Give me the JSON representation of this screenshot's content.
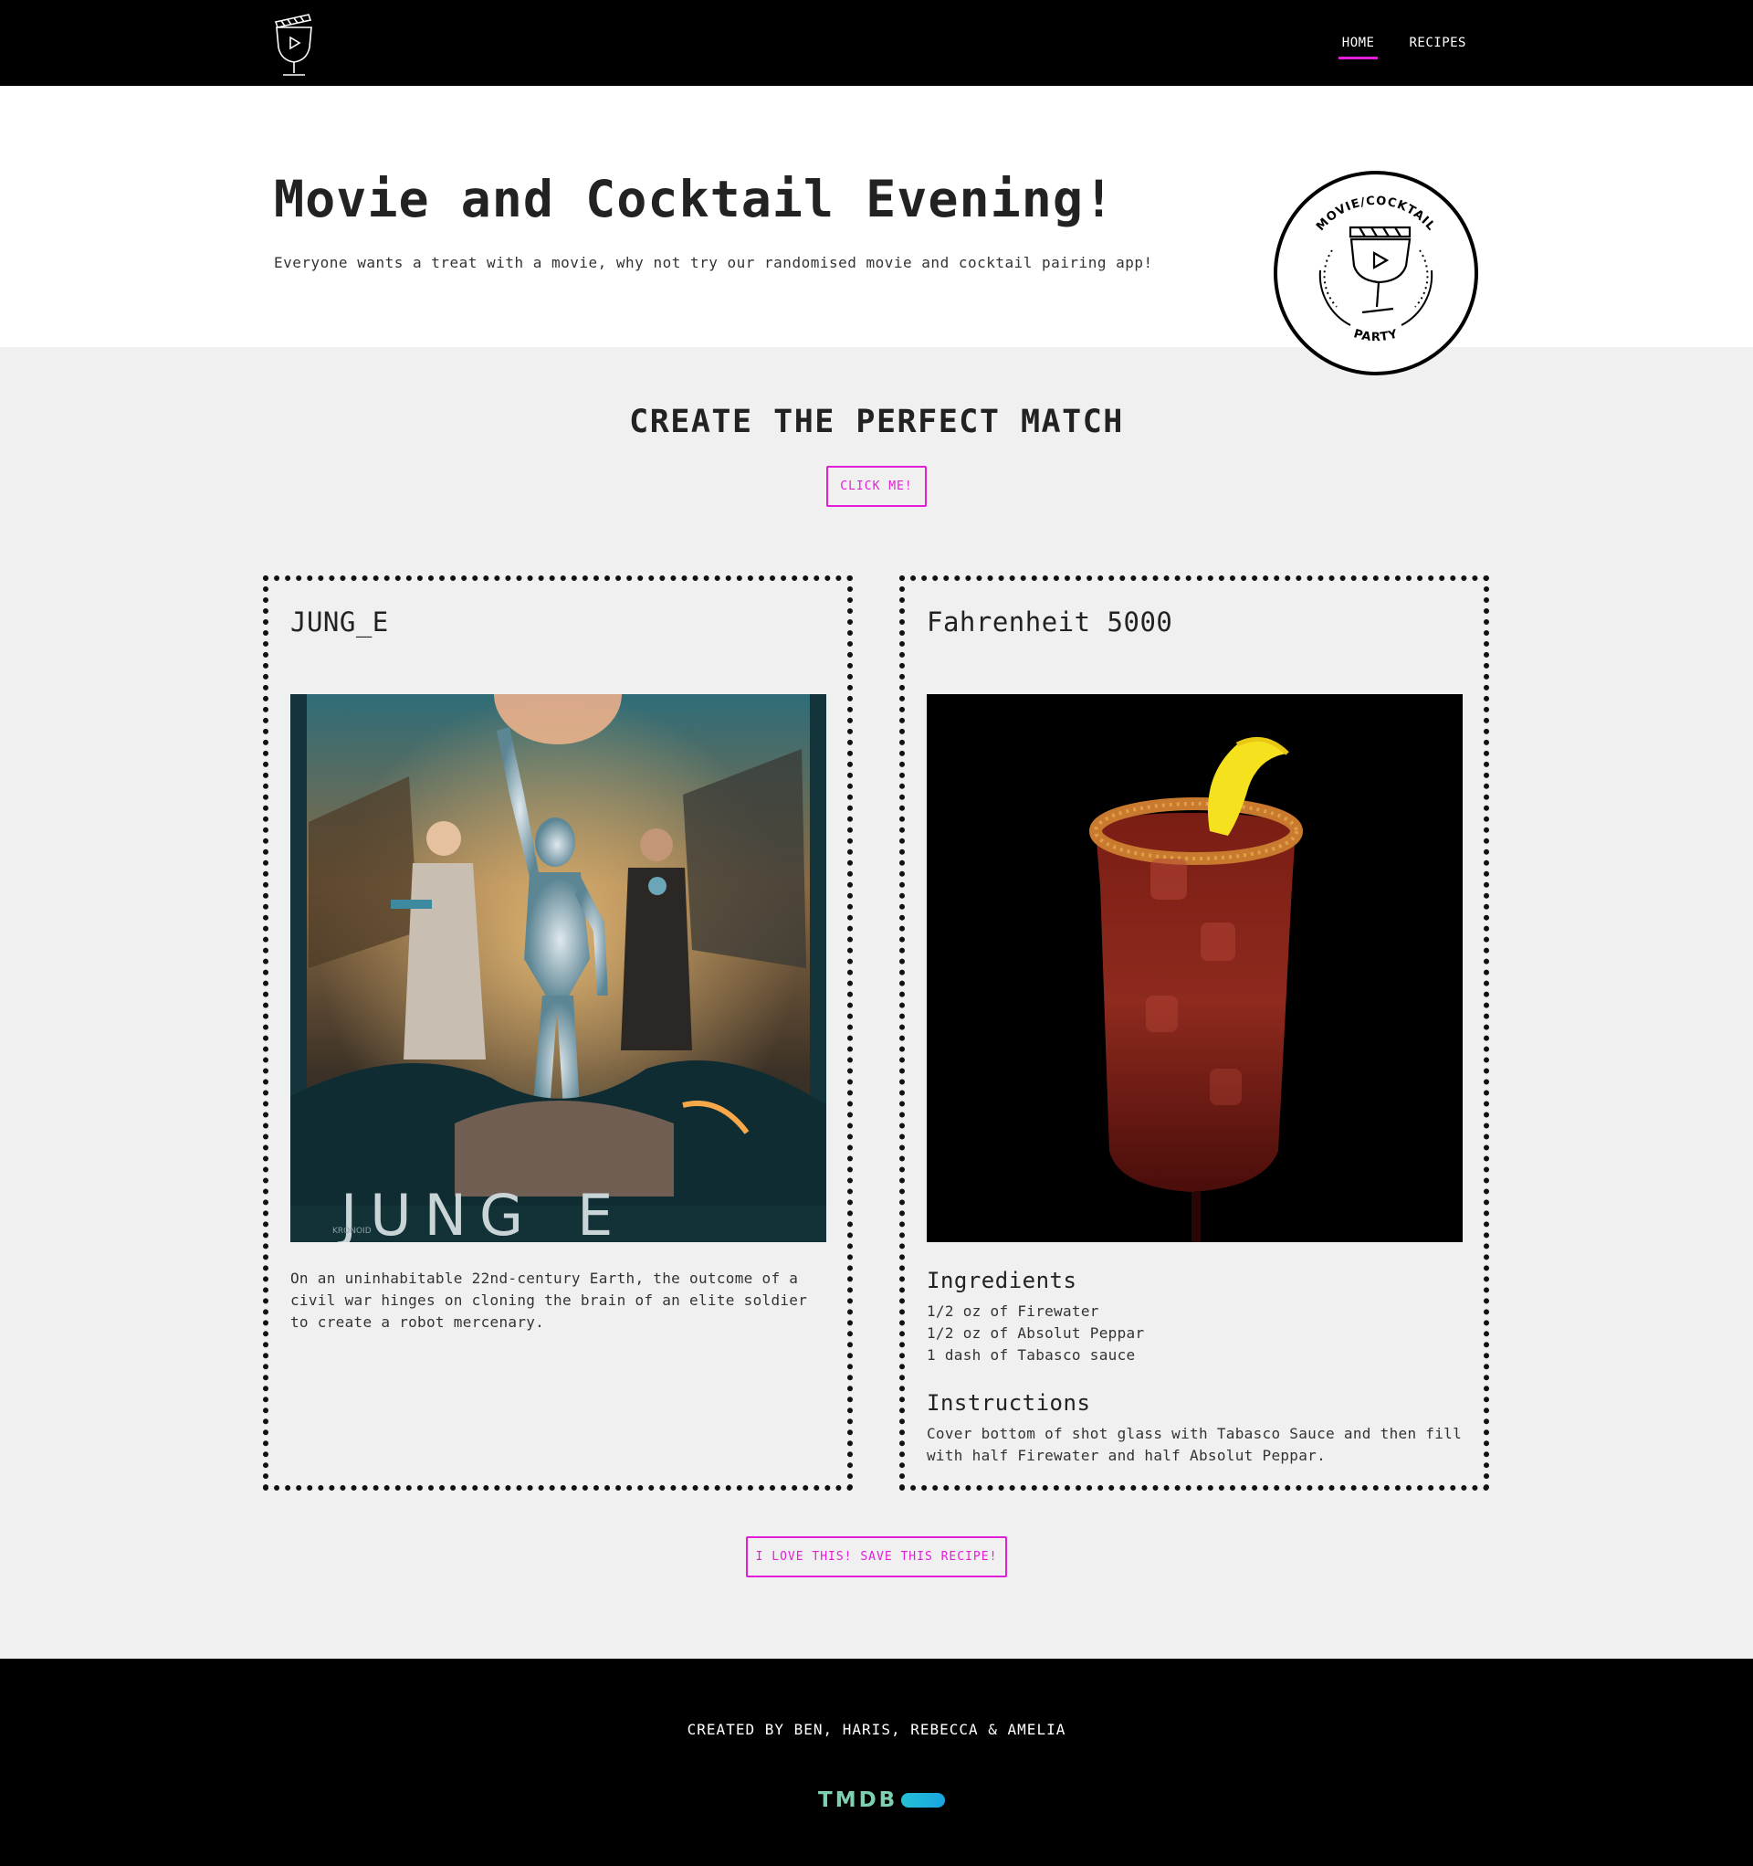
{
  "nav": {
    "logo_icon": "cocktail-clapper-logo",
    "links": [
      {
        "label": "HOME",
        "active": true
      },
      {
        "label": "RECIPES",
        "active": false
      }
    ]
  },
  "hero": {
    "title": "Movie and Cocktail Evening!",
    "subtitle": "Everyone wants a treat with a movie, why not try our randomised movie and cocktail pairing app!",
    "badge": {
      "top_text": "MOVIE/COCKTAIL",
      "bottom_text": "PARTY"
    }
  },
  "match": {
    "heading": "CREATE THE PERFECT MATCH",
    "click_label": "CLICK ME!",
    "save_label": "I LOVE THIS! SAVE THIS RECIPE!"
  },
  "movie": {
    "title": "JUNG_E",
    "poster_text": "JUNG_E",
    "poster_studio": "KRONOID",
    "description": "On an uninhabitable 22nd-century Earth, the outcome of a civil war hinges on cloning the brain of an elite soldier to create a robot mercenary."
  },
  "drink": {
    "title": "Fahrenheit 5000",
    "ingredients_heading": "Ingredients",
    "ingredients": [
      "1/2 oz of Firewater",
      "1/2 oz of Absolut Peppar",
      "1 dash of Tabasco sauce"
    ],
    "instructions_heading": "Instructions",
    "instructions": "Cover bottom of shot glass with Tabasco Sauce and then fill with half Firewater and half Absolut Peppar."
  },
  "footer": {
    "credit": "CREATED BY BEN, HARIS, REBECCA & AMELIA",
    "tmdb_text": "TMDB"
  },
  "colors": {
    "accent": "#e21fd6",
    "nav_bg": "#000000",
    "section_bg": "#f0f0f0"
  }
}
